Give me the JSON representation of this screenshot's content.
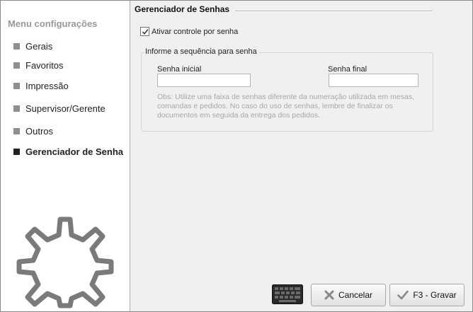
{
  "sidebar": {
    "title": "Menu configurações",
    "items": [
      {
        "label": "Gerais"
      },
      {
        "label": "Favoritos"
      },
      {
        "label": "Impressão"
      },
      {
        "label": "Supervisor/Gerente"
      },
      {
        "label": "Outros"
      },
      {
        "label": "Gerenciador de Senha",
        "active": true
      }
    ],
    "decoration_icon": "gear-icon"
  },
  "main": {
    "section_title": "Gerenciador de Senhas",
    "checkbox": {
      "label": "Ativar controle por senha",
      "checked": true
    },
    "group": {
      "legend": "Informe a sequência para senha",
      "start_label": "Senha inicial",
      "start_value": "",
      "end_label": "Senha final",
      "end_value": "",
      "note": "Obs: Utilize uma faixa de senhas diferente da numeração utilizada em mesas, comandas e pedidos. No caso do uso de senhas, lembre de finalizar os documentos em seguida da entrega dos pedidos."
    }
  },
  "footer": {
    "keyboard_icon": "keyboard-icon",
    "cancel_label": "Cancelar",
    "save_label": "F3 - Gravar"
  },
  "colors": {
    "accent_check": "#5a8a2a",
    "cancel_x": "#888888",
    "gear_stroke": "#7a7a7a"
  }
}
